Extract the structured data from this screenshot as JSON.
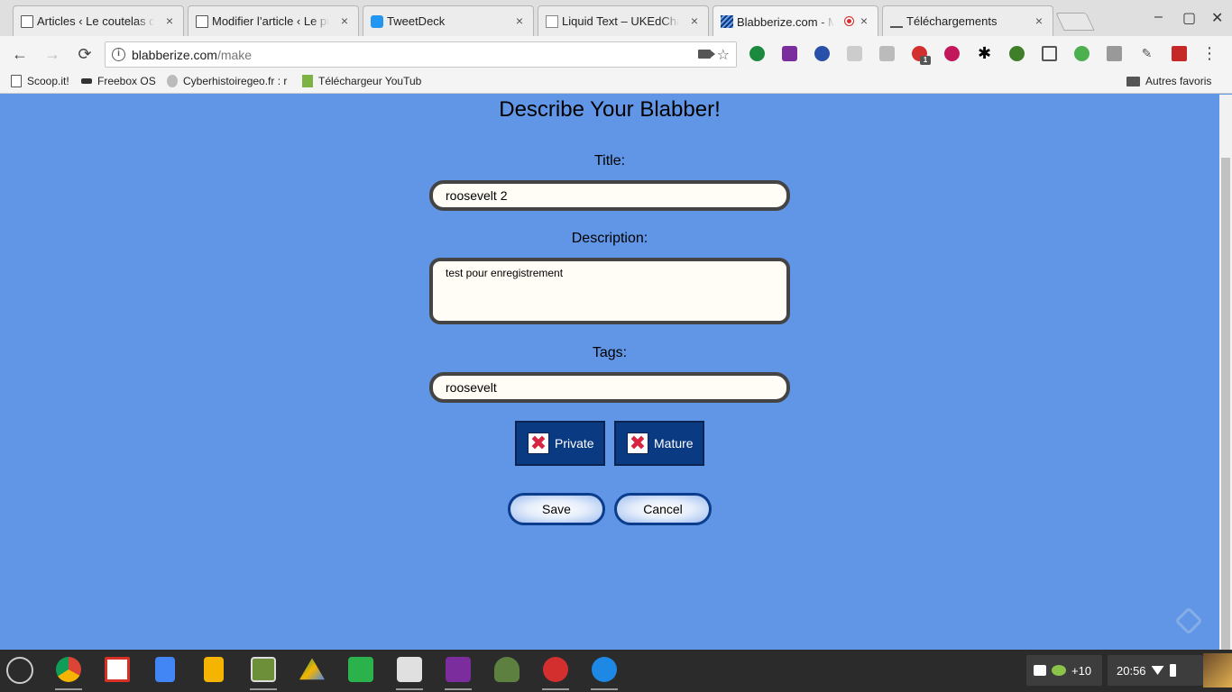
{
  "browser": {
    "tabs": [
      {
        "title": "Articles ‹ Le coutelas de",
        "close": "×"
      },
      {
        "title": "Modifier l’article ‹ Le pro",
        "close": "×"
      },
      {
        "title": "TweetDeck",
        "close": "×"
      },
      {
        "title": "Liquid Text – UKEdChat",
        "close": "×"
      },
      {
        "title": "Blabberize.com - Ma",
        "close": "×"
      },
      {
        "title": "Téléchargements",
        "close": "×"
      }
    ],
    "window_controls": {
      "minimize": "–",
      "maximize": "▢",
      "close": "✕"
    },
    "nav": {
      "back": "←",
      "forward": "→",
      "reload": "⟳"
    },
    "address": {
      "domain": "blabberize.com",
      "path": "/make"
    },
    "ext_badge": "1",
    "bookmarks": [
      {
        "label": "Scoop.it!"
      },
      {
        "label": "Freebox OS"
      },
      {
        "label": "Cyberhistoiregeo.fr : r"
      },
      {
        "label": "Téléchargeur YouTub"
      }
    ],
    "other_bookmarks": "Autres favoris"
  },
  "page": {
    "heading": "Describe Your Blabber!",
    "title_label": "Title:",
    "title_value": "roosevelt 2",
    "description_label": "Description:",
    "description_value": "test pour enregistrement",
    "tags_label": "Tags:",
    "tags_value": "roosevelt",
    "private_label": "Private",
    "mature_label": "Mature",
    "toggle_mark": "✖",
    "save_label": "Save",
    "cancel_label": "Cancel"
  },
  "shelf": {
    "notif_count": "+10",
    "clock": "20:56"
  },
  "colors": {
    "page_bg": "#6196e6",
    "toggle_bg": "#0a3a82",
    "toggle_x": "#d7243f",
    "pill_border": "#0b3d8c"
  }
}
